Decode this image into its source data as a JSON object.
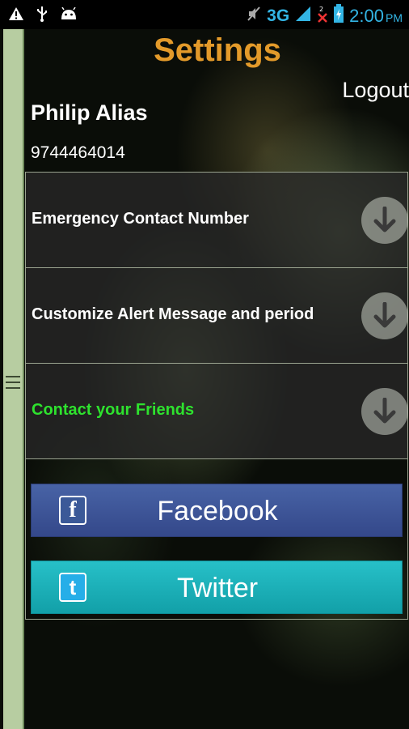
{
  "status_bar": {
    "network": "3G",
    "time": "2:00",
    "ampm": "PM"
  },
  "header": {
    "title": "Settings",
    "logout_label": "Logout"
  },
  "user": {
    "name": "Philip Alias",
    "phone": "9744464014"
  },
  "settings_rows": [
    {
      "label": "Emergency Contact Number"
    },
    {
      "label": "Customize Alert Message and period"
    },
    {
      "label": "Contact your Friends",
      "color": "#2ee22e"
    }
  ],
  "social": {
    "facebook_label": "Facebook",
    "facebook_logo": "f",
    "twitter_label": "Twitter",
    "twitter_logo": "t"
  },
  "colors": {
    "title": "#e39a2a",
    "status_accent": "#33b5e5",
    "facebook": "#3b5998",
    "twitter": "#1bb0b8",
    "drawer": "#b7cda1"
  }
}
